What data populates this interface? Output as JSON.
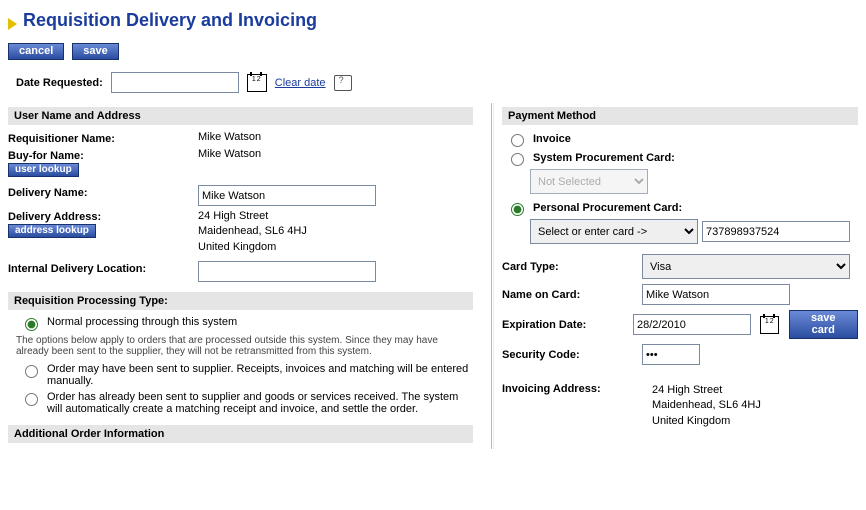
{
  "page_title": "Requisition Delivery and Invoicing",
  "buttons": {
    "cancel": "cancel",
    "save": "save",
    "user_lookup": "user lookup",
    "address_lookup": "address lookup",
    "save_card": "save card"
  },
  "date_requested": {
    "label": "Date Requested:",
    "value": "",
    "clear_link": "Clear date"
  },
  "left": {
    "section_user": "User Name and Address",
    "requisitioner_label": "Requisitioner Name:",
    "requisitioner_value": "Mike Watson",
    "buyfor_label": "Buy-for Name:",
    "buyfor_value": "Mike Watson",
    "delivery_name_label": "Delivery Name:",
    "delivery_name_value": "Mike Watson",
    "delivery_addr_label": "Delivery Address:",
    "delivery_addr_line1": "24 High Street",
    "delivery_addr_line2": "Maidenhead, SL6 4HJ",
    "delivery_addr_line3": "United Kingdom",
    "internal_loc_label": "Internal Delivery Location:",
    "internal_loc_value": "",
    "section_proc": "Requisition Processing Type:",
    "opt_normal": "Normal processing through this system",
    "proc_help": "The options below apply to orders that are processed outside this system. Since they may have already been sent to the supplier, they will not be retransmitted from this system.",
    "opt_maybe": "Order may have been sent to supplier. Receipts, invoices and matching will be entered manually.",
    "opt_already": "Order has already been sent to supplier and goods or services received. The system will automatically create a matching receipt and invoice, and settle the order.",
    "section_add": "Additional Order Information"
  },
  "right": {
    "section_payment": "Payment Method",
    "opt_invoice": "Invoice",
    "opt_syscard": "System Procurement Card:",
    "syscard_sel_placeholder": "Not Selected",
    "opt_personal": "Personal Procurement Card:",
    "personal_sel_placeholder": "Select or enter card ->",
    "personal_card_number": "737898937524",
    "card_type_label": "Card Type:",
    "card_type_value": "Visa",
    "name_on_card_label": "Name on Card:",
    "name_on_card_value": "Mike Watson",
    "exp_label": "Expiration Date:",
    "exp_value": "28/2/2010",
    "sec_label": "Security Code:",
    "sec_value": "•••",
    "inv_addr_label": "Invoicing Address:",
    "inv_addr_line1": "24 High Street",
    "inv_addr_line2": "Maidenhead, SL6 4HJ",
    "inv_addr_line3": "United Kingdom"
  }
}
